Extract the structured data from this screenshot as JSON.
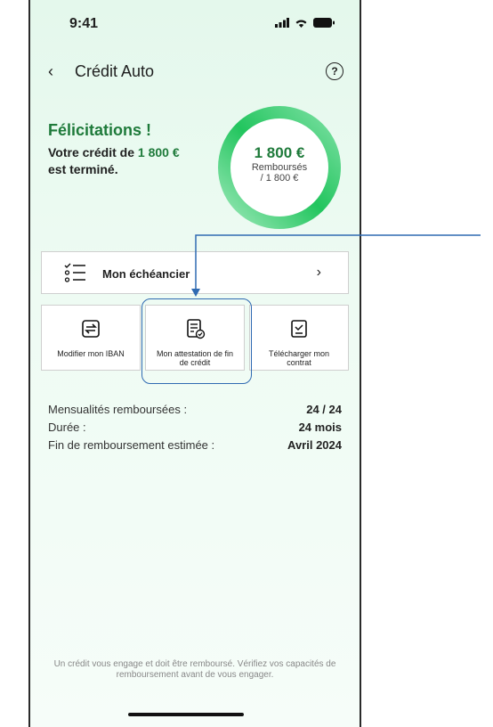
{
  "status": {
    "time": "9:41"
  },
  "nav": {
    "back": "‹",
    "title": "Crédit Auto",
    "help": "?"
  },
  "summary": {
    "headline": "Félicitations !",
    "line1_prefix": "Votre crédit de ",
    "line1_amount": "1 800 €",
    "line2": "est terminé."
  },
  "ring": {
    "amount": "1 800 €",
    "sub1": "Remboursés",
    "sub2": "/ 1 800 €",
    "progress": 1.0,
    "color": "#22c55e"
  },
  "schedule": {
    "label": "Mon échéancier",
    "chevron": "›"
  },
  "actions": [
    {
      "label": "Modifier mon IBAN"
    },
    {
      "label": "Mon attestation de fin de crédit"
    },
    {
      "label": "Télécharger mon contrat"
    }
  ],
  "details": [
    {
      "label": "Mensualités remboursées :",
      "value": "24 / 24"
    },
    {
      "label": "Durée :",
      "value": "24 mois"
    },
    {
      "label": "Fin de remboursement estimée :",
      "value": "Avril 2024"
    }
  ],
  "legal": "Un crédit vous engage et doit être remboursé. Vérifiez vos capacités de remboursement avant de vous engager.",
  "colors": {
    "accent": "#1e7a3a",
    "annotation": "#2f6ab2"
  }
}
